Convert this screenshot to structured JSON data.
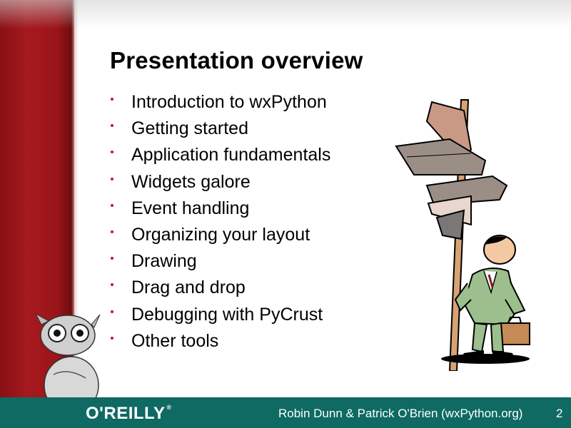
{
  "slide": {
    "title": "Presentation overview",
    "bullets": [
      "Introduction to wxPython",
      "Getting started",
      "Application fundamentals",
      "Widgets galore",
      "Event handling",
      "Organizing your layout",
      "Drawing",
      "Drag and drop",
      "Debugging with PyCrust",
      "Other tools"
    ]
  },
  "footer": {
    "logo_text": "O'REILLY",
    "logo_mark": "®",
    "authors": "Robin Dunn  &  Patrick O'Brien   (wxPython.org)",
    "page_number": "2"
  },
  "colors": {
    "band": "#a51a1f",
    "footer": "#0e6a62",
    "bullet": "#c0181d"
  },
  "images": {
    "tarsier": "tarsier-illustration",
    "signpost": "signpost-man-illustration"
  }
}
